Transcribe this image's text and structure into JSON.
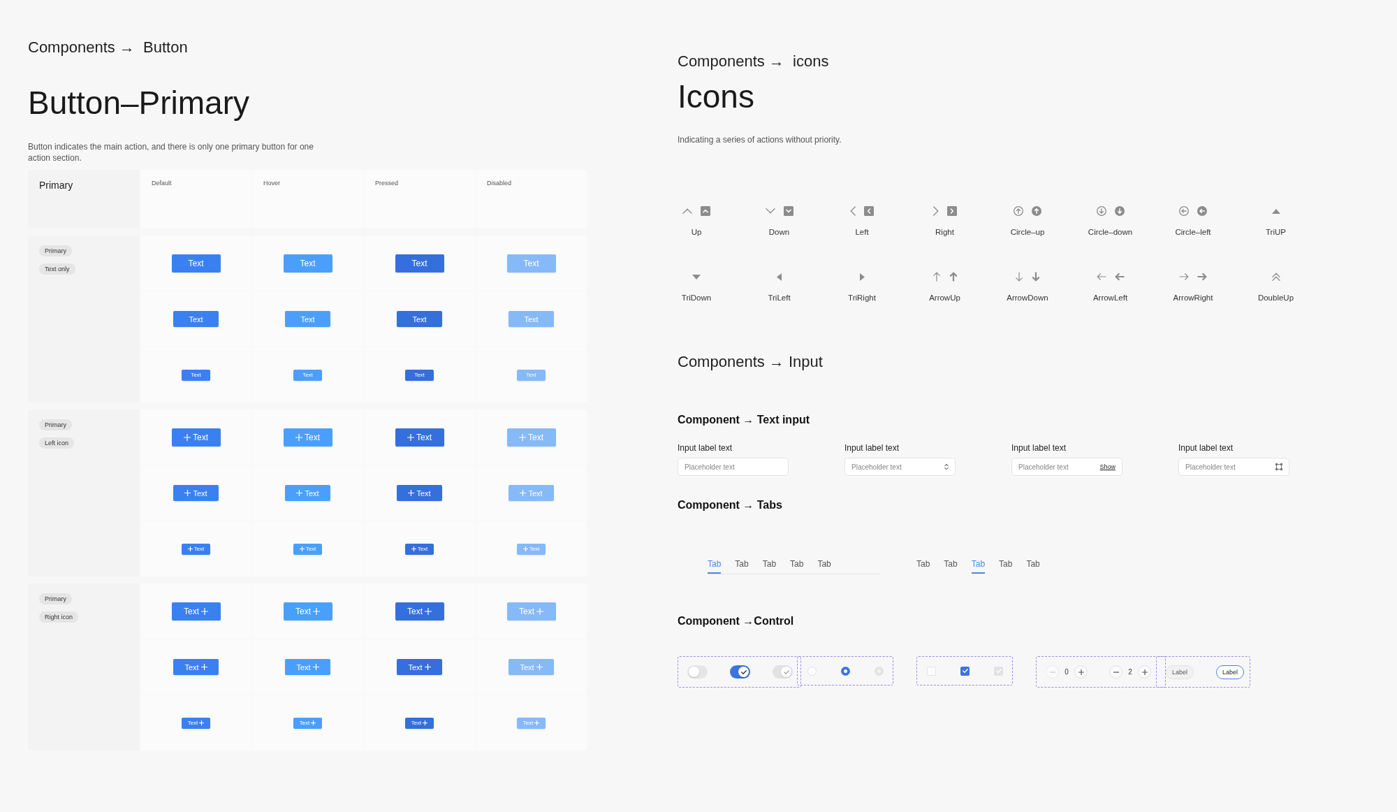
{
  "button_page": {
    "breadcrumb": "Components →  Button",
    "title": "Button–Primary",
    "description": "Button indicates the main action, and there is only one primary button for one action section.",
    "table": {
      "corner_label": "Primary",
      "columns": [
        "Default",
        "Hover",
        "Pressed",
        "Disabled"
      ],
      "groups": [
        {
          "kind": "plain",
          "tags": [
            "Primary",
            "Text only"
          ],
          "rows": [
            {
              "kind": "large",
              "buttons": [
                {
                  "label": "Text",
                  "kind": "default"
                },
                {
                  "label": "Text",
                  "kind": "hover"
                },
                {
                  "label": "Text",
                  "kind": "pressed"
                },
                {
                  "label": "Text",
                  "kind": "disabled"
                }
              ]
            },
            {
              "kind": "medium",
              "buttons": [
                {
                  "label": "Text",
                  "kind": "default"
                },
                {
                  "label": "Text",
                  "kind": "hover"
                },
                {
                  "label": "Text",
                  "kind": "pressed"
                },
                {
                  "label": "Text",
                  "kind": "disabled"
                }
              ]
            },
            {
              "kind": "small",
              "buttons": [
                {
                  "label": "Text",
                  "kind": "default"
                },
                {
                  "label": "Text",
                  "kind": "hover"
                },
                {
                  "label": "Text",
                  "kind": "pressed"
                },
                {
                  "label": "Text",
                  "kind": "disabled"
                }
              ]
            }
          ]
        },
        {
          "kind": "iconleft",
          "tags": [
            "Primary",
            "Left icon"
          ],
          "rows": [
            {
              "kind": "large",
              "buttons": [
                {
                  "label": "Text",
                  "kind": "default"
                },
                {
                  "label": "Text",
                  "kind": "hover"
                },
                {
                  "label": "Text",
                  "kind": "pressed"
                },
                {
                  "label": "Text",
                  "kind": "disabled"
                }
              ]
            },
            {
              "kind": "medium",
              "buttons": [
                {
                  "label": "Text",
                  "kind": "default"
                },
                {
                  "label": "Text",
                  "kind": "hover"
                },
                {
                  "label": "Text",
                  "kind": "pressed"
                },
                {
                  "label": "Text",
                  "kind": "disabled"
                }
              ]
            },
            {
              "kind": "small",
              "buttons": [
                {
                  "label": "Text",
                  "kind": "default"
                },
                {
                  "label": "Text",
                  "kind": "hover"
                },
                {
                  "label": "Text",
                  "kind": "pressed"
                },
                {
                  "label": "Text",
                  "kind": "disabled"
                }
              ]
            }
          ]
        },
        {
          "kind": "iconright",
          "tags": [
            "Primary",
            "Right icon"
          ],
          "rows": [
            {
              "kind": "large",
              "buttons": [
                {
                  "label": "Text",
                  "kind": "default"
                },
                {
                  "label": "Text",
                  "kind": "hover"
                },
                {
                  "label": "Text",
                  "kind": "pressed"
                },
                {
                  "label": "Text",
                  "kind": "disabled"
                }
              ]
            },
            {
              "kind": "medium",
              "buttons": [
                {
                  "label": "Text",
                  "kind": "default"
                },
                {
                  "label": "Text",
                  "kind": "hover"
                },
                {
                  "label": "Text",
                  "kind": "pressed"
                },
                {
                  "label": "Text",
                  "kind": "disabled"
                }
              ]
            },
            {
              "kind": "small",
              "buttons": [
                {
                  "label": "Text",
                  "kind": "default"
                },
                {
                  "label": "Text",
                  "kind": "hover"
                },
                {
                  "label": "Text",
                  "kind": "pressed"
                },
                {
                  "label": "Text",
                  "kind": "disabled"
                }
              ]
            }
          ]
        }
      ]
    }
  },
  "icons_page": {
    "breadcrumb": "Components →  icons",
    "title": "Icons",
    "description": "Indicating a series of actions without priority.",
    "icons": [
      {
        "kind": "up",
        "label": "Up"
      },
      {
        "kind": "down",
        "label": "Down"
      },
      {
        "kind": "left",
        "label": "Left"
      },
      {
        "kind": "right",
        "label": "Right"
      },
      {
        "kind": "circleup",
        "label": "Circle–up"
      },
      {
        "kind": "circledown",
        "label": "Circle–down"
      },
      {
        "kind": "circleleft",
        "label": "Circle–left"
      },
      {
        "kind": "triup",
        "label": "TriUP"
      },
      {
        "kind": "tridown",
        "label": "TriDown"
      },
      {
        "kind": "trileft",
        "label": "TriLeft"
      },
      {
        "kind": "triright",
        "label": "TriRight"
      },
      {
        "kind": "arrowup",
        "label": "ArrowUp"
      },
      {
        "kind": "arrowdown",
        "label": "ArrowDown"
      },
      {
        "kind": "arrowleft",
        "label": "ArrowLeft"
      },
      {
        "kind": "arrowright",
        "label": "ArrowRight"
      },
      {
        "kind": "doubleup",
        "label": "DoubleUp"
      }
    ]
  },
  "input_page": {
    "heading": "Components → Input",
    "text_input": {
      "heading": "Component → Text input",
      "fields": [
        {
          "kind": "text",
          "label": "Input label text",
          "placeholder": "Placeholder text"
        },
        {
          "kind": "select",
          "label": "Input label text",
          "placeholder": "Placeholder text"
        },
        {
          "kind": "password",
          "label": "Input label text",
          "placeholder": "Placeholder text",
          "action": "Show"
        },
        {
          "kind": "frame",
          "label": "Input label text",
          "placeholder": "Placeholder text"
        }
      ]
    },
    "tabs": {
      "heading": "Component → Tabs",
      "groups": [
        {
          "underline_track": true,
          "tabs": [
            {
              "label": "Tab",
              "selected": true
            },
            {
              "label": "Tab",
              "selected": false
            },
            {
              "label": "Tab",
              "selected": false
            },
            {
              "label": "Tab",
              "selected": false
            },
            {
              "label": "Tab",
              "selected": false
            }
          ]
        },
        {
          "tabs": [
            {
              "label": "Tab",
              "selected": false
            },
            {
              "label": "Tab",
              "selected": false
            },
            {
              "label": "Tab",
              "selected": true
            },
            {
              "label": "Tab",
              "selected": false
            },
            {
              "label": "Tab",
              "selected": false
            }
          ]
        }
      ]
    },
    "control": {
      "heading": "Component →Control",
      "groups": [
        {
          "kind": "toggle",
          "items": [
            {
              "on": false,
              "disabled": false
            },
            {
              "on": true,
              "disabled": false
            },
            {
              "on": true,
              "disabled": true
            }
          ]
        },
        {
          "kind": "radio",
          "items": [
            {
              "selected": false,
              "disabled": false
            },
            {
              "selected": true,
              "disabled": false
            },
            {
              "selected": true,
              "disabled": true
            }
          ]
        },
        {
          "kind": "checkbox",
          "items": [
            {
              "checked": false,
              "disabled": false
            },
            {
              "checked": true,
              "disabled": false
            },
            {
              "checked": true,
              "disabled": true
            }
          ]
        },
        {
          "kind": "stepper",
          "items": [
            {
              "value": "0",
              "minus_disabled": true
            },
            {
              "value": "2",
              "minus_disabled": false
            }
          ]
        },
        {
          "kind": "chip",
          "items": [
            {
              "label": "Label",
              "selected": false
            },
            {
              "label": "Label",
              "selected": true
            }
          ]
        }
      ]
    }
  }
}
